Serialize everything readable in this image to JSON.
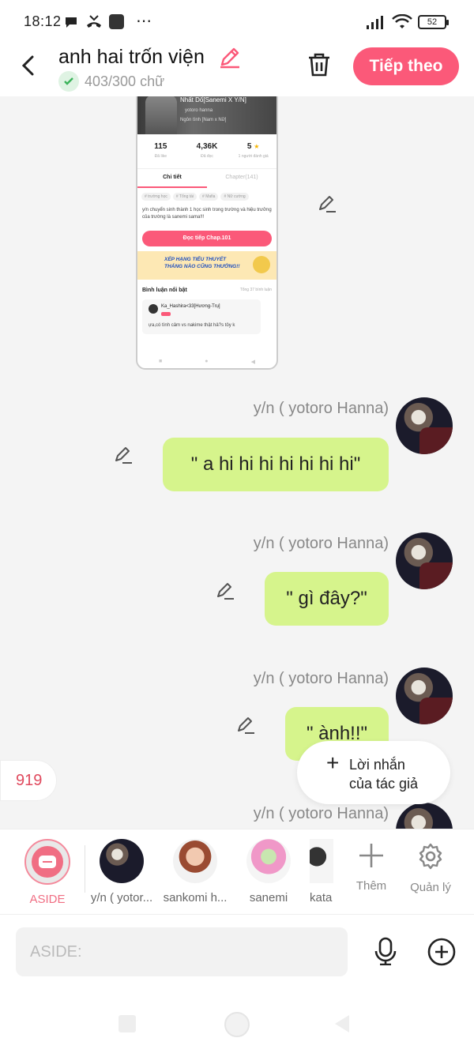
{
  "status_bar": {
    "time": "18:12",
    "more": "⋯",
    "battery": "52"
  },
  "header": {
    "title": "anh hai trốn viện",
    "word_count": "403/300 chữ",
    "next_label": "Tiếp theo",
    "accent": "#fb5979"
  },
  "story_card": {
    "title": "Nhất Dố[Sanemi X Y/N]",
    "author": "yotoro hanna",
    "genre": "Ngôn tình [Nam x Nữ]",
    "stats": [
      {
        "value": "115",
        "label": "Đã like"
      },
      {
        "value": "4,36K",
        "label": "Đã đọc"
      },
      {
        "value": "5",
        "label": "1 người đánh giá"
      }
    ],
    "tabs": [
      "Chi tiết",
      "Chapter(141)"
    ],
    "tags": [
      "# trường học",
      "# Tổng tài",
      "# Mafia",
      "# Nữ cường"
    ],
    "description": "y/n chuyển sinh thành 1 học sinh trong trường và hiệu trưởng của trường là sanemi sama!!!",
    "read_button": "Đọc tiếp Chap.101",
    "ranking_line1": "XẾP HẠNG TIỂU THUYẾT",
    "ranking_line2": "THÁNG NÀO CŨNG THƯỞNG!!",
    "comments_title": "Bình luận nổi bật",
    "comments_total": "Tổng 37 bình luận",
    "comment_user": "Ka_Hashira<33[Hương-Trụ]",
    "comment_text": "ựa,có tình cảm vs nakime thật hả?s tôy k"
  },
  "messages": [
    {
      "sender": "y/n ( yotoro Hanna)",
      "text": "\" a hi hi hi hi hi hi hi\""
    },
    {
      "sender": "y/n ( yotoro Hanna)",
      "text": "\" gì đây?\""
    },
    {
      "sender": "y/n ( yotoro Hanna)",
      "text": "\" ành!!\""
    },
    {
      "sender": "y/n ( yotoro Hanna)",
      "text": ""
    }
  ],
  "floating": {
    "comment_count": "919",
    "author_note_line1": "Lời nhắn",
    "author_note_line2": "của tác giả"
  },
  "characters": [
    {
      "label": "ASIDE"
    },
    {
      "label": "y/n ( yotor..."
    },
    {
      "label": "sankomi h..."
    },
    {
      "label": "sanemi"
    },
    {
      "label": "kata"
    }
  ],
  "actions": {
    "add_label": "Thêm",
    "manage_label": "Quản lý"
  },
  "input": {
    "placeholder": "ASIDE:"
  }
}
